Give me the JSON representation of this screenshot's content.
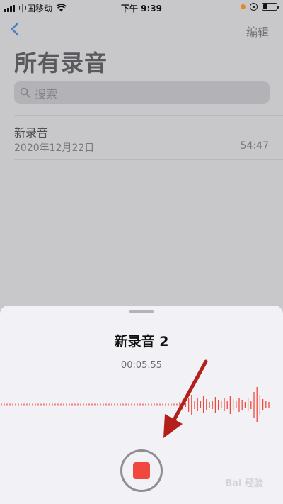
{
  "status_bar": {
    "carrier": "中国移动",
    "time": "下午 9:39"
  },
  "nav": {
    "edit_label": "编辑",
    "back_icon": "chevron-left-icon"
  },
  "page": {
    "title": "所有录音",
    "search_placeholder": "搜索"
  },
  "recordings": [
    {
      "title": "新录音",
      "date": "2020年12月22日",
      "duration": "54:47"
    }
  ],
  "sheet": {
    "title": "新录音 2",
    "timer": "00:05.55",
    "record_state": "recording",
    "accent_color": "#f0483e"
  },
  "annotation": {
    "arrow_color": "#b3201b"
  },
  "watermark": "Bai 经验"
}
